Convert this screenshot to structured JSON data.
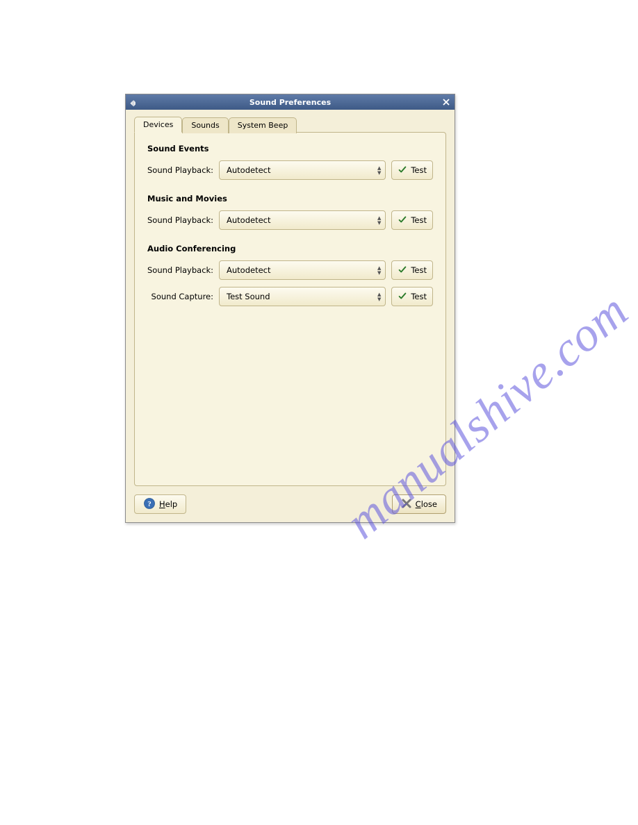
{
  "window": {
    "title": "Sound Preferences"
  },
  "tabs": {
    "devices": "Devices",
    "sounds": "Sounds",
    "system_beep": "System Beep"
  },
  "sections": {
    "sound_events": {
      "header": "Sound Events",
      "playback_label": "Sound Playback:",
      "playback_value": "Autodetect",
      "test_label": "Test"
    },
    "music_movies": {
      "header": "Music and Movies",
      "playback_label": "Sound Playback:",
      "playback_value": "Autodetect",
      "test_label": "Test"
    },
    "audio_conferencing": {
      "header": "Audio Conferencing",
      "playback_label": "Sound Playback:",
      "playback_value": "Autodetect",
      "playback_test_label": "Test",
      "capture_label": "Sound Capture:",
      "capture_value": "Test Sound",
      "capture_test_label": "Test"
    }
  },
  "footer": {
    "help": "Help",
    "close": "Close"
  },
  "watermark": "manualshive.com"
}
